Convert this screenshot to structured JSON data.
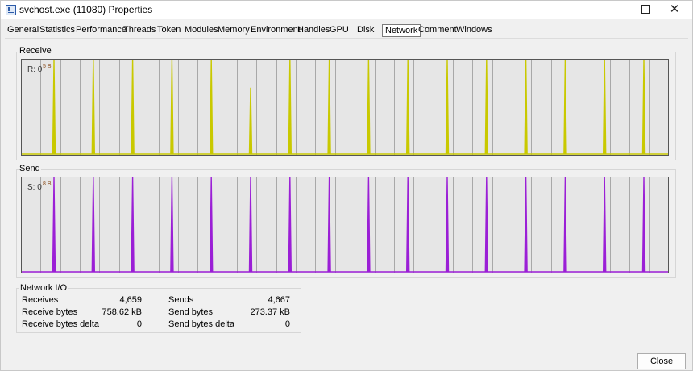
{
  "window": {
    "title": "svchost.exe (11080) Properties",
    "icon": "process-window-icon",
    "controls": {
      "minimize": "minimize-icon",
      "maximize": "maximize-icon",
      "close": "close-icon"
    }
  },
  "tabs": [
    {
      "label": "General"
    },
    {
      "label": "Statistics"
    },
    {
      "label": "Performance"
    },
    {
      "label": "Threads"
    },
    {
      "label": "Token"
    },
    {
      "label": "Modules"
    },
    {
      "label": "Memory"
    },
    {
      "label": "Environment"
    },
    {
      "label": "Handles"
    },
    {
      "label": "GPU"
    },
    {
      "label": "Disk"
    },
    {
      "label": "Network"
    },
    {
      "label": "Comment"
    },
    {
      "label": "Windows"
    }
  ],
  "active_tab": "Network",
  "receive": {
    "group_label": "Receive",
    "current_prefix": "R: 0",
    "current_unit": "5 B",
    "line_color": "#c9c900",
    "spikes_count": 16,
    "spike_values": [
      1,
      1,
      1,
      1,
      1,
      1,
      1,
      1,
      1,
      1,
      1,
      1,
      1,
      1,
      1,
      1
    ],
    "one_lower_spike": 0.7
  },
  "send": {
    "group_label": "Send",
    "current_prefix": "S: 0",
    "current_unit": "8 B",
    "line_color": "#9b1fd6",
    "spikes_count": 16,
    "spike_values": [
      1,
      1,
      1,
      1,
      1,
      1,
      1,
      1,
      1,
      1,
      1,
      1,
      1,
      1,
      1,
      1
    ]
  },
  "network_io": {
    "title": "Network I/O",
    "left": [
      {
        "label": "Receives",
        "value": "4,659"
      },
      {
        "label": "Receive bytes",
        "value": "758.62 kB"
      },
      {
        "label": "Receive bytes delta",
        "value": "0"
      }
    ],
    "right": [
      {
        "label": "Sends",
        "value": "4,667"
      },
      {
        "label": "Send bytes",
        "value": "273.37 kB"
      },
      {
        "label": "Send bytes delta",
        "value": "0"
      }
    ]
  },
  "footer": {
    "close_label": "Close"
  }
}
